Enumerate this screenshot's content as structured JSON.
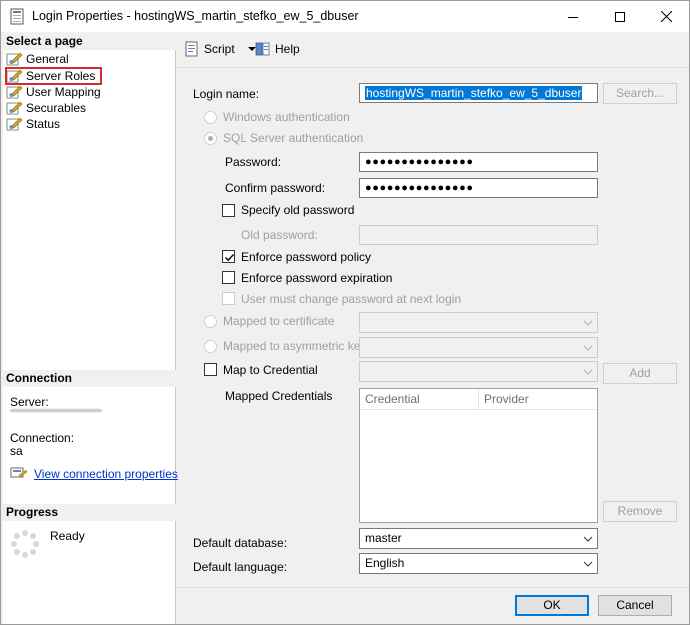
{
  "window": {
    "title": "Login Properties - hostingWS_martin_stefko_ew_5_dbuser",
    "accent_color": "#0078d7",
    "highlight_color": "#d7282a"
  },
  "left_pane": {
    "select_page_header": "Select a page",
    "pages": [
      {
        "label": "General",
        "icon": "wrench-page-icon"
      },
      {
        "label": "Server Roles",
        "icon": "wrench-page-icon",
        "selected": true
      },
      {
        "label": "User Mapping",
        "icon": "wrench-page-icon"
      },
      {
        "label": "Securables",
        "icon": "wrench-page-icon"
      },
      {
        "label": "Status",
        "icon": "wrench-page-icon"
      }
    ],
    "connection_header": "Connection",
    "server_label": "Server:",
    "connection_label": "Connection:",
    "connection_value": "sa",
    "view_connection_link": "View connection properties",
    "progress_header": "Progress",
    "progress_status": "Ready"
  },
  "toolbar": {
    "script_label": "Script",
    "help_label": "Help"
  },
  "form": {
    "login_name_label": "Login name:",
    "login_name_value": "hostingWS_martin_stefko_ew_5_dbuser",
    "search_button": "Search...",
    "windows_auth_label": "Windows authentication",
    "sql_auth_label": "SQL Server authentication",
    "password_label": "Password:",
    "password_value": "●●●●●●●●●●●●●●●",
    "confirm_password_label": "Confirm password:",
    "confirm_password_value": "●●●●●●●●●●●●●●●",
    "specify_old_password_label": "Specify old password",
    "specify_old_password_checked": false,
    "old_password_label": "Old password:",
    "enforce_policy_label": "Enforce password policy",
    "enforce_policy_checked": true,
    "enforce_expiration_label": "Enforce password expiration",
    "enforce_expiration_checked": false,
    "must_change_label": "User must change password at next login",
    "must_change_checked": false,
    "mapped_certificate_label": "Mapped to certificate",
    "mapped_asym_key_label": "Mapped to asymmetric key",
    "map_credential_label": "Map to Credential",
    "map_credential_checked": false,
    "add_button": "Add",
    "mapped_credentials_label": "Mapped Credentials",
    "credentials_columns": [
      "Credential",
      "Provider"
    ],
    "remove_button": "Remove",
    "default_database_label": "Default database:",
    "default_database_value": "master",
    "default_language_label": "Default language:",
    "default_language_value": "English"
  },
  "buttons": {
    "ok": "OK",
    "cancel": "Cancel"
  }
}
